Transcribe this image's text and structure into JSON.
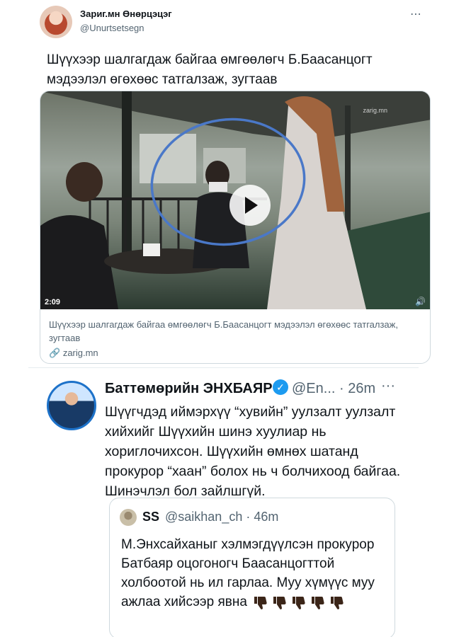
{
  "tweet1": {
    "author_name": "Зариг.мн Өнөрцэцэг",
    "author_handle": "@Unurtsetsegn",
    "more_label": "⋯",
    "text": "Шүүхээр шалгагдаж байгаа өмгөөлөгч Б.Баасанцогт мэдээлэл өгөхөөс татгалзаж, зугтаав",
    "card": {
      "video_duration": "2:09",
      "watermark": "zarig.mn",
      "title": "Шүүхээр шалгагдаж байгаа өмгөөлөгч Б.Баасанцогт мэдээлэл өгөхөөс татгалзаж, зугтаав",
      "link": "zarig.mn"
    }
  },
  "tweet2": {
    "author_name": "Баттөмөрийн ЭНХБАЯР",
    "author_handle": "@En...",
    "time": "26m",
    "more_label": "···",
    "text": "Шүүгчдэд иймэрхүү “хувийн” уулзалт уулзалт хийхийг Шүүхийн шинэ хуулиар нь хориглочихсон. Шүүхийн өмнөх шатанд прокурор “хаан” болох нь ч болчихоод байгаа. Шинэчлэл бол зайлшгүй.",
    "quote": {
      "author_name": "SS",
      "author_handle": "@saikhan_ch",
      "time": "46m",
      "text": "М.Энхсайханыг хэлмэгдүүлсэн прокурор Батбаяр оцогоногч Баасанцогттой холбоотой нь ил гарлаа. Муу хүмүүс муу ажлаа хийсээр явна",
      "thumbs_count": 5
    }
  },
  "icons": {
    "verified": "verified-badge-icon",
    "link": "link-icon",
    "play": "play-icon",
    "volume": "volume-icon",
    "thumbs": "thumbs-down-icon"
  },
  "colors": {
    "accent": "#1d9bf0",
    "secondary_text": "#536471",
    "border": "#cfd9de",
    "circle_annotation": "#4a78c8"
  }
}
